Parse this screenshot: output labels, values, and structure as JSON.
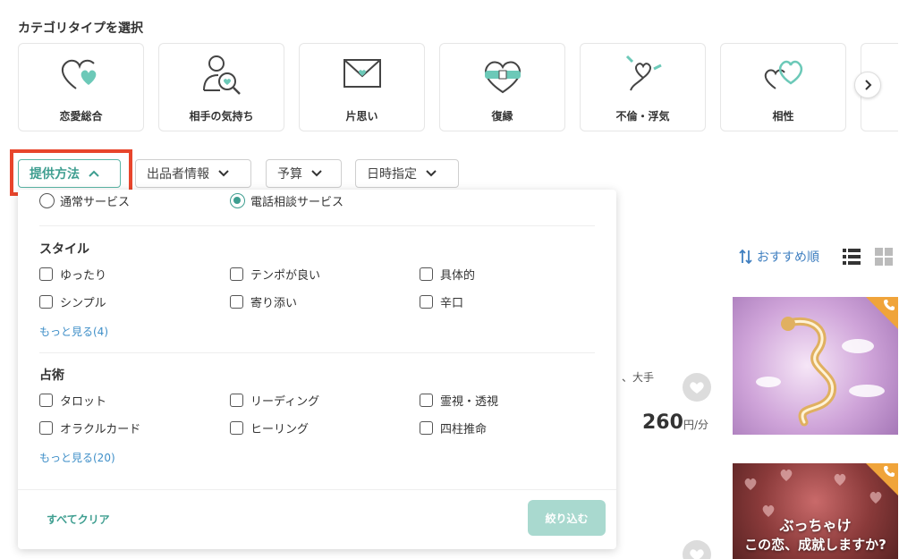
{
  "section_title": "カテゴリタイプを選択",
  "categories": [
    {
      "label": "恋愛総合",
      "icon": "heart-icon"
    },
    {
      "label": "相手の気持ち",
      "icon": "person-search-icon"
    },
    {
      "label": "片思い",
      "icon": "envelope-heart-icon"
    },
    {
      "label": "復縁",
      "icon": "bandaged-heart-icon"
    },
    {
      "label": "不倫・浮気",
      "icon": "tangled-heart-icon"
    },
    {
      "label": "相性",
      "icon": "two-hearts-icon"
    }
  ],
  "filters": [
    {
      "label": "提供方法",
      "active": true
    },
    {
      "label": "出品者情報",
      "active": false
    },
    {
      "label": "予算",
      "active": false
    },
    {
      "label": "日時指定",
      "active": false
    }
  ],
  "panel": {
    "service_options": [
      {
        "label": "通常サービス",
        "selected": false
      },
      {
        "label": "電話相談サービス",
        "selected": true
      }
    ],
    "groups": [
      {
        "title": "スタイル",
        "options": [
          "ゆったり",
          "テンポが良い",
          "具体的",
          "シンプル",
          "寄り添い",
          "辛口"
        ],
        "more": "もっと見る(4)"
      },
      {
        "title": "占術",
        "options": [
          "タロット",
          "リーディング",
          "霊視・透視",
          "オラクルカード",
          "ヒーリング",
          "四柱推命"
        ],
        "more": "もっと見る(20)"
      }
    ],
    "clear_label": "すべてクリア",
    "apply_label": "絞り込む"
  },
  "sort_label": "おすすめ順",
  "listing": {
    "snippet": "、大手",
    "price": "260",
    "price_unit": "円/分",
    "thumb2_line1": "ぶっちゃけ",
    "thumb2_line2": "この恋、成就しますか?"
  },
  "colors": {
    "accent": "#3e9e90",
    "highlight": "#e8452c",
    "link": "#3f8fc8",
    "badge": "#f0a43a"
  }
}
